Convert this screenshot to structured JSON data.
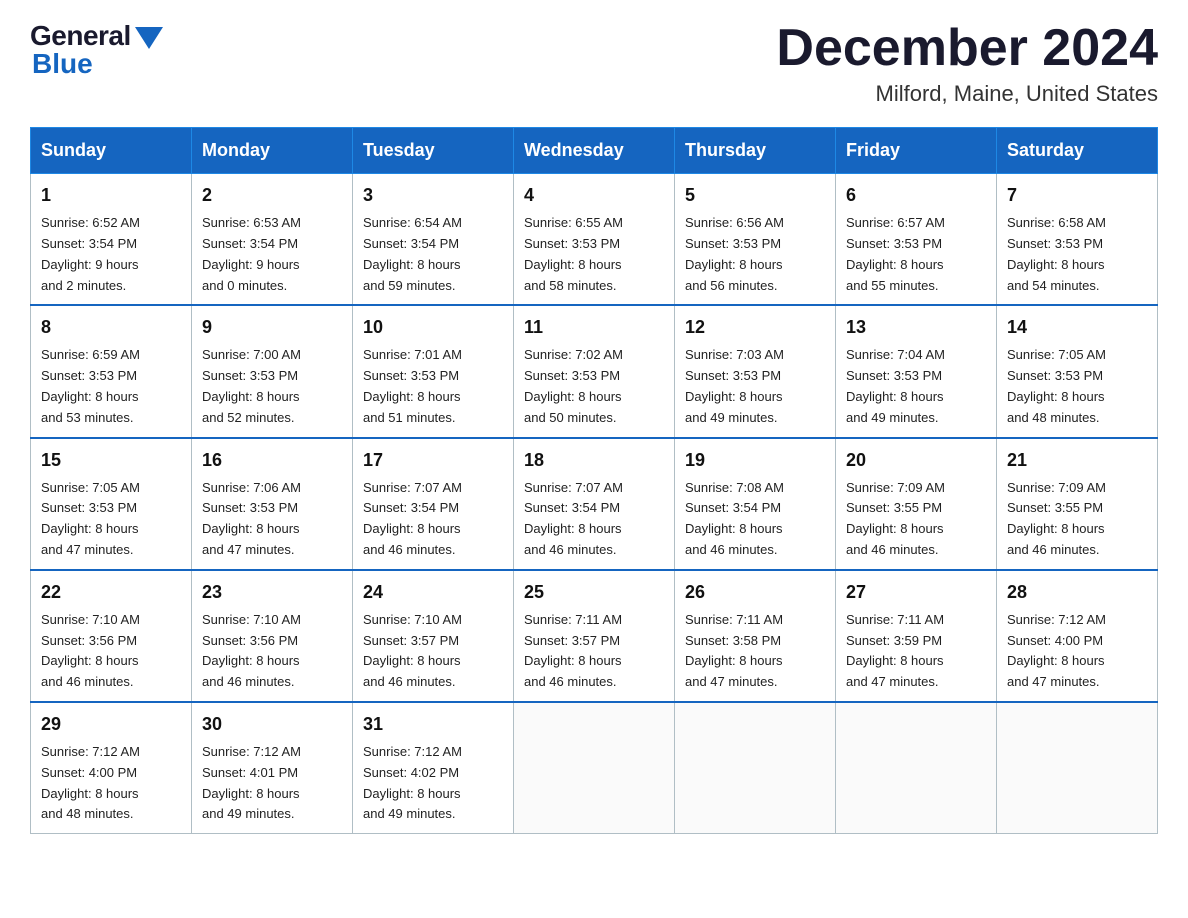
{
  "logo": {
    "general": "General",
    "blue": "Blue"
  },
  "header": {
    "title": "December 2024",
    "location": "Milford, Maine, United States"
  },
  "days_of_week": [
    "Sunday",
    "Monday",
    "Tuesday",
    "Wednesday",
    "Thursday",
    "Friday",
    "Saturday"
  ],
  "weeks": [
    [
      {
        "day": "1",
        "sunrise": "6:52 AM",
        "sunset": "3:54 PM",
        "daylight": "9 hours and 2 minutes."
      },
      {
        "day": "2",
        "sunrise": "6:53 AM",
        "sunset": "3:54 PM",
        "daylight": "9 hours and 0 minutes."
      },
      {
        "day": "3",
        "sunrise": "6:54 AM",
        "sunset": "3:54 PM",
        "daylight": "8 hours and 59 minutes."
      },
      {
        "day": "4",
        "sunrise": "6:55 AM",
        "sunset": "3:53 PM",
        "daylight": "8 hours and 58 minutes."
      },
      {
        "day": "5",
        "sunrise": "6:56 AM",
        "sunset": "3:53 PM",
        "daylight": "8 hours and 56 minutes."
      },
      {
        "day": "6",
        "sunrise": "6:57 AM",
        "sunset": "3:53 PM",
        "daylight": "8 hours and 55 minutes."
      },
      {
        "day": "7",
        "sunrise": "6:58 AM",
        "sunset": "3:53 PM",
        "daylight": "8 hours and 54 minutes."
      }
    ],
    [
      {
        "day": "8",
        "sunrise": "6:59 AM",
        "sunset": "3:53 PM",
        "daylight": "8 hours and 53 minutes."
      },
      {
        "day": "9",
        "sunrise": "7:00 AM",
        "sunset": "3:53 PM",
        "daylight": "8 hours and 52 minutes."
      },
      {
        "day": "10",
        "sunrise": "7:01 AM",
        "sunset": "3:53 PM",
        "daylight": "8 hours and 51 minutes."
      },
      {
        "day": "11",
        "sunrise": "7:02 AM",
        "sunset": "3:53 PM",
        "daylight": "8 hours and 50 minutes."
      },
      {
        "day": "12",
        "sunrise": "7:03 AM",
        "sunset": "3:53 PM",
        "daylight": "8 hours and 49 minutes."
      },
      {
        "day": "13",
        "sunrise": "7:04 AM",
        "sunset": "3:53 PM",
        "daylight": "8 hours and 49 minutes."
      },
      {
        "day": "14",
        "sunrise": "7:05 AM",
        "sunset": "3:53 PM",
        "daylight": "8 hours and 48 minutes."
      }
    ],
    [
      {
        "day": "15",
        "sunrise": "7:05 AM",
        "sunset": "3:53 PM",
        "daylight": "8 hours and 47 minutes."
      },
      {
        "day": "16",
        "sunrise": "7:06 AM",
        "sunset": "3:53 PM",
        "daylight": "8 hours and 47 minutes."
      },
      {
        "day": "17",
        "sunrise": "7:07 AM",
        "sunset": "3:54 PM",
        "daylight": "8 hours and 46 minutes."
      },
      {
        "day": "18",
        "sunrise": "7:07 AM",
        "sunset": "3:54 PM",
        "daylight": "8 hours and 46 minutes."
      },
      {
        "day": "19",
        "sunrise": "7:08 AM",
        "sunset": "3:54 PM",
        "daylight": "8 hours and 46 minutes."
      },
      {
        "day": "20",
        "sunrise": "7:09 AM",
        "sunset": "3:55 PM",
        "daylight": "8 hours and 46 minutes."
      },
      {
        "day": "21",
        "sunrise": "7:09 AM",
        "sunset": "3:55 PM",
        "daylight": "8 hours and 46 minutes."
      }
    ],
    [
      {
        "day": "22",
        "sunrise": "7:10 AM",
        "sunset": "3:56 PM",
        "daylight": "8 hours and 46 minutes."
      },
      {
        "day": "23",
        "sunrise": "7:10 AM",
        "sunset": "3:56 PM",
        "daylight": "8 hours and 46 minutes."
      },
      {
        "day": "24",
        "sunrise": "7:10 AM",
        "sunset": "3:57 PM",
        "daylight": "8 hours and 46 minutes."
      },
      {
        "day": "25",
        "sunrise": "7:11 AM",
        "sunset": "3:57 PM",
        "daylight": "8 hours and 46 minutes."
      },
      {
        "day": "26",
        "sunrise": "7:11 AM",
        "sunset": "3:58 PM",
        "daylight": "8 hours and 47 minutes."
      },
      {
        "day": "27",
        "sunrise": "7:11 AM",
        "sunset": "3:59 PM",
        "daylight": "8 hours and 47 minutes."
      },
      {
        "day": "28",
        "sunrise": "7:12 AM",
        "sunset": "4:00 PM",
        "daylight": "8 hours and 47 minutes."
      }
    ],
    [
      {
        "day": "29",
        "sunrise": "7:12 AM",
        "sunset": "4:00 PM",
        "daylight": "8 hours and 48 minutes."
      },
      {
        "day": "30",
        "sunrise": "7:12 AM",
        "sunset": "4:01 PM",
        "daylight": "8 hours and 49 minutes."
      },
      {
        "day": "31",
        "sunrise": "7:12 AM",
        "sunset": "4:02 PM",
        "daylight": "8 hours and 49 minutes."
      },
      null,
      null,
      null,
      null
    ]
  ],
  "labels": {
    "sunrise": "Sunrise:",
    "sunset": "Sunset:",
    "daylight": "Daylight:"
  }
}
